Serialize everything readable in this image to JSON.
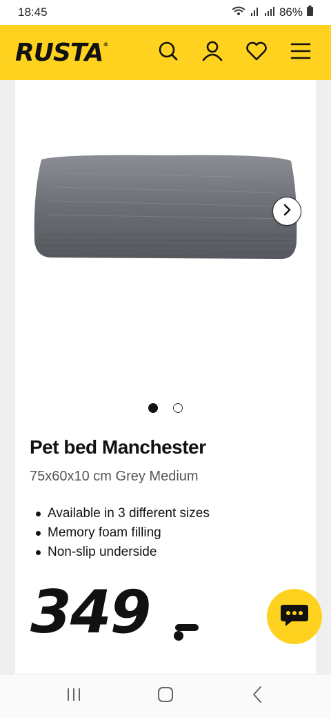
{
  "status_bar": {
    "time": "18:45",
    "battery": "86%",
    "icons": [
      "wifi-calling-icon",
      "signal-icon",
      "signal-icon",
      "battery-icon"
    ]
  },
  "header": {
    "logo": "RUSTA",
    "logo_mark": "®",
    "icons": [
      "search-icon",
      "account-icon",
      "favorites-heart-icon",
      "menu-icon"
    ],
    "accent_color": "#ffd21f"
  },
  "gallery": {
    "image": "pet-bed-grey-cushion-image",
    "next_icon": "chevron-right-icon",
    "slide_count": 2,
    "current_slide": 1
  },
  "product": {
    "title": "Pet bed Manchester",
    "subtitle": "75x60x10 cm Grey Medium",
    "features": [
      "Available in 3 different sizes",
      "Memory foam filling",
      "Non-slip underside"
    ],
    "price": "349"
  },
  "chat": {
    "icon": "chat-bubble-icon"
  },
  "nav_bar": {
    "icons": [
      "recent-apps-icon",
      "home-icon",
      "back-icon"
    ]
  }
}
